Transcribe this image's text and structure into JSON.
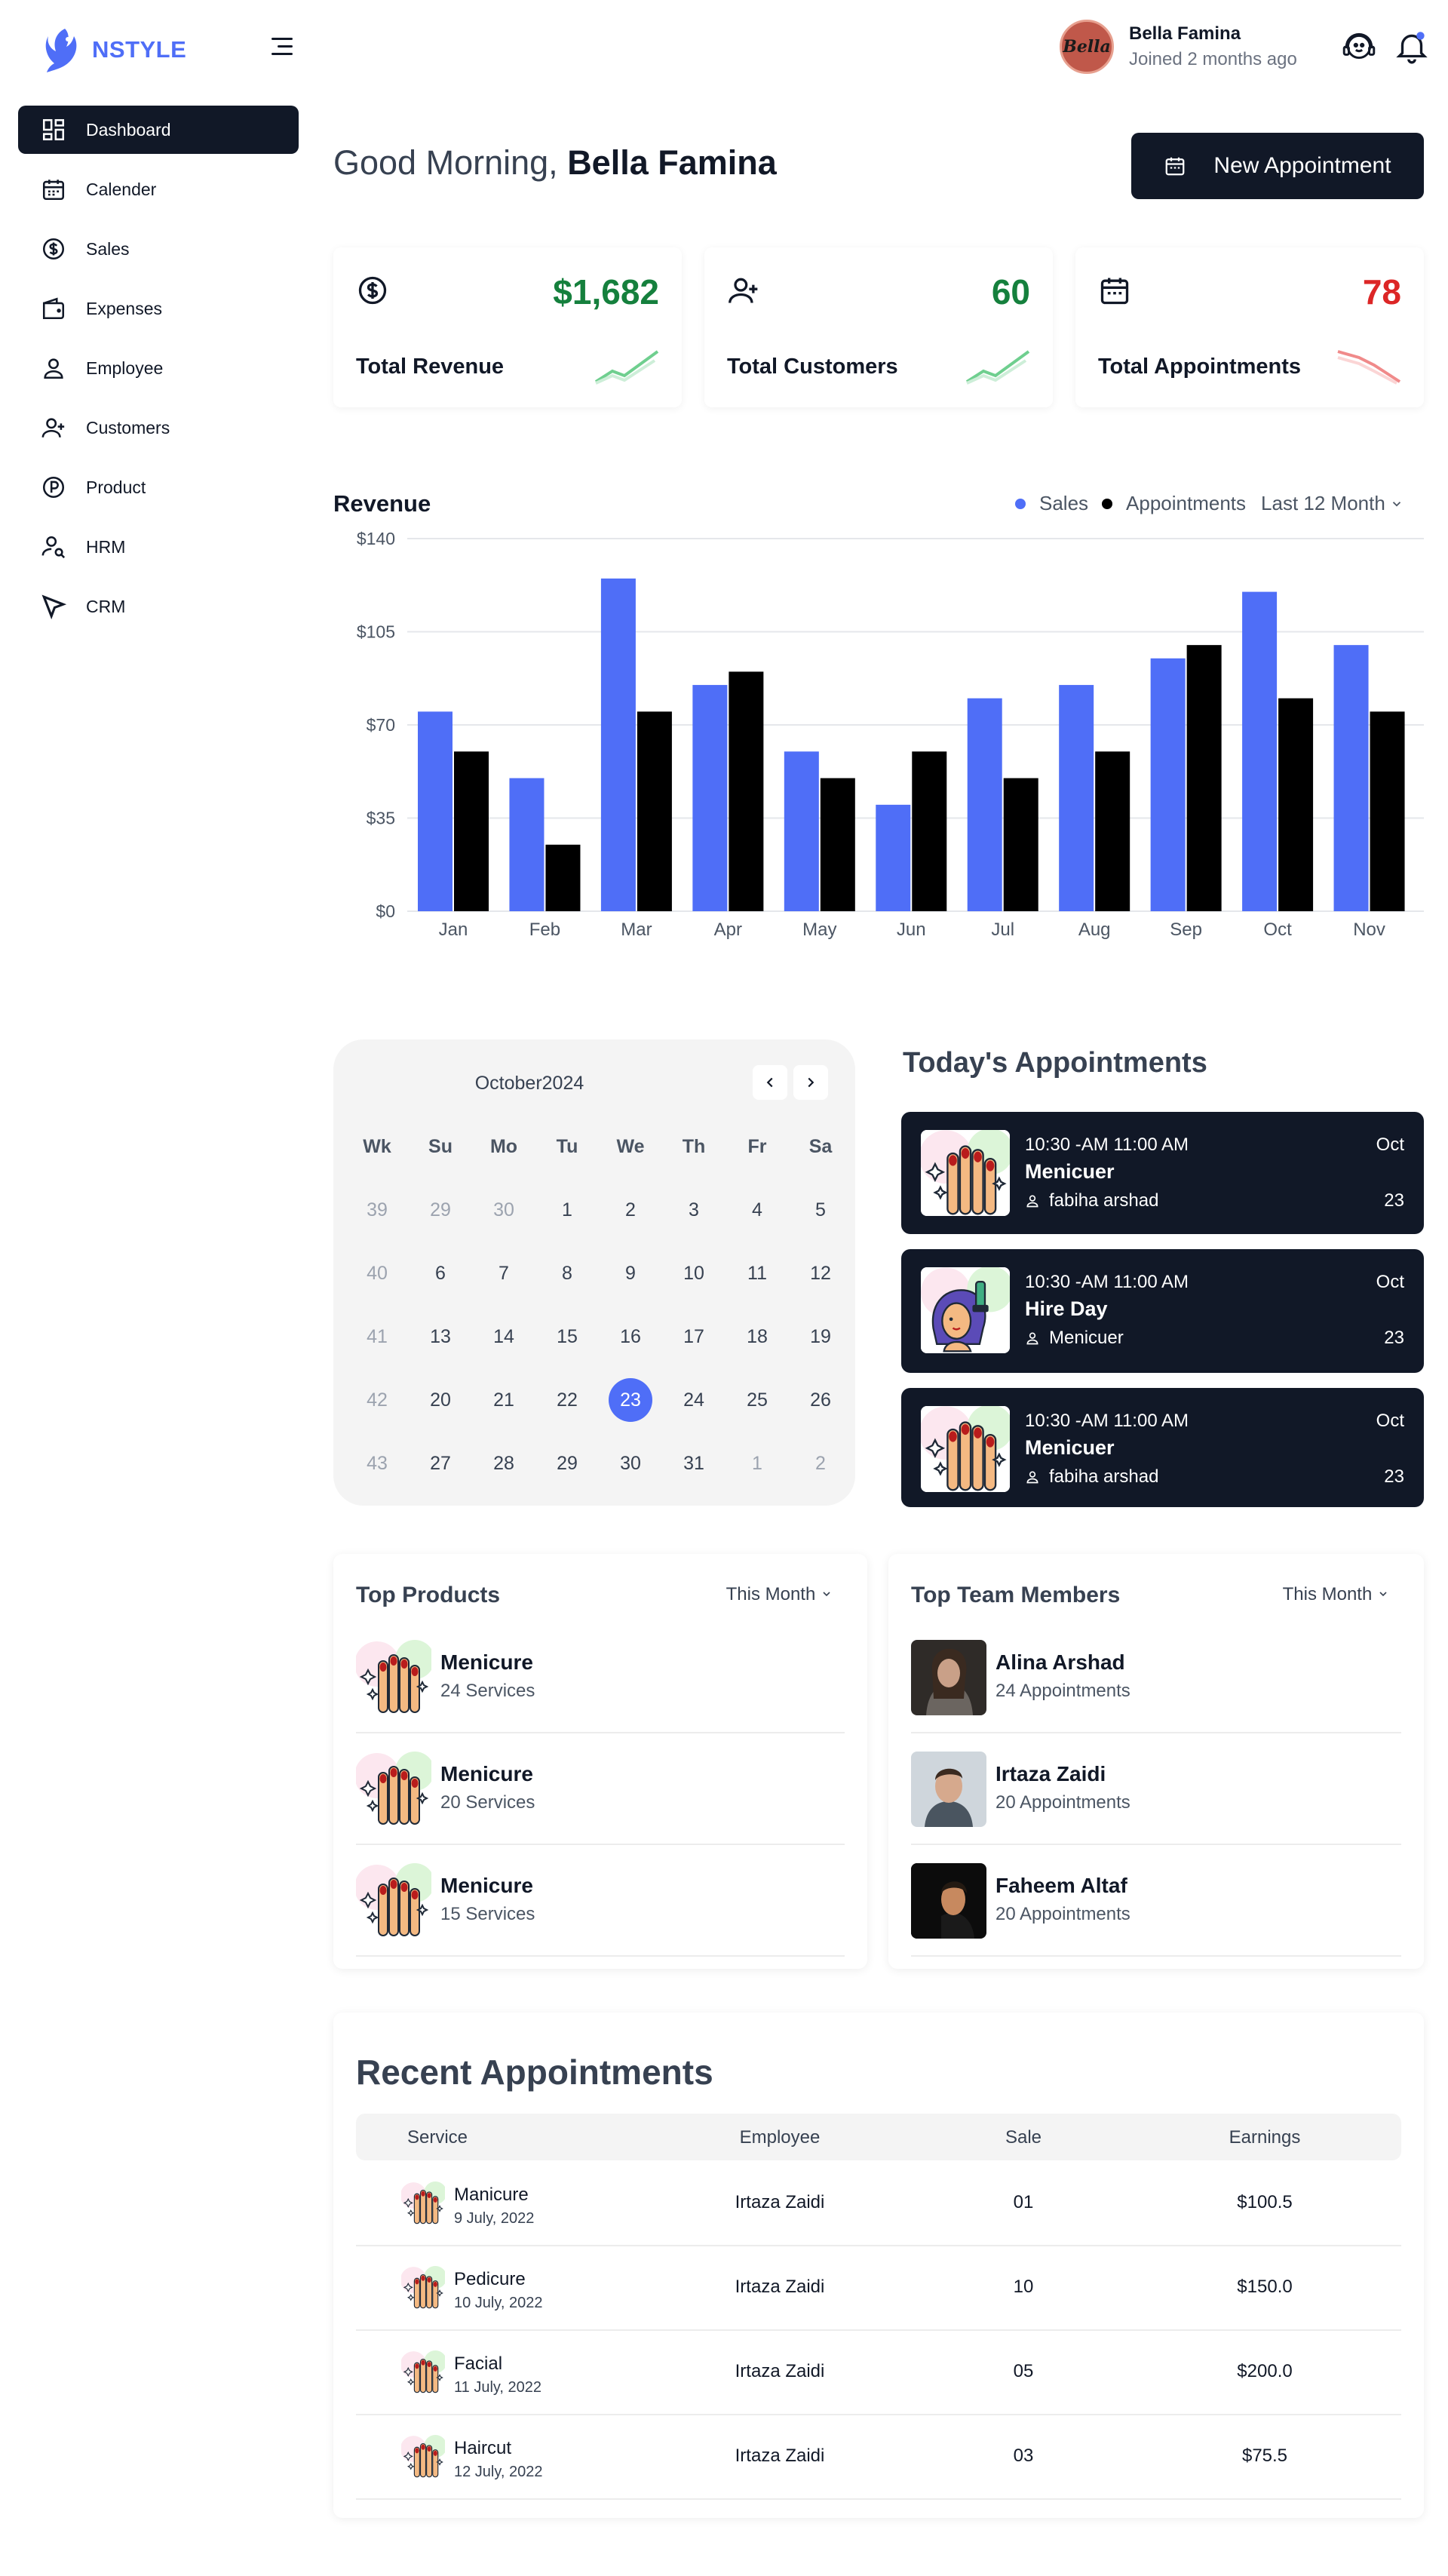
{
  "brand": {
    "name": "NSTYLE",
    "color": "#4f6ef7"
  },
  "sidebar": {
    "items": [
      {
        "label": "Dashboard",
        "icon": "dashboard-icon",
        "active": true
      },
      {
        "label": "Calender",
        "icon": "calendar-icon"
      },
      {
        "label": "Sales",
        "icon": "dollar-circle-icon"
      },
      {
        "label": "Expenses",
        "icon": "wallet-icon"
      },
      {
        "label": "Employee",
        "icon": "user-icon"
      },
      {
        "label": "Customers",
        "icon": "user-plus-icon"
      },
      {
        "label": "Product",
        "icon": "product-p-icon"
      },
      {
        "label": "HRM",
        "icon": "user-search-icon"
      },
      {
        "label": "CRM",
        "icon": "send-arrow-icon"
      }
    ]
  },
  "header": {
    "profile_name": "Bella Famina",
    "profile_joined": "Joined 2 months ago",
    "avatar_text": "Bella",
    "support_icon": "headset-icon",
    "notification_icon": "bell-icon"
  },
  "greeting": {
    "prefix": "Good Morning,",
    "name": "Bella Famina"
  },
  "new_appointment": {
    "label": "New Appointment"
  },
  "stats": [
    {
      "value": "$1,682",
      "label": "Total Revenue",
      "value_color": "#15803d",
      "trend": "up"
    },
    {
      "value": "60",
      "label": "Total Customers",
      "value_color": "#15803d",
      "trend": "up"
    },
    {
      "value": "78",
      "label": "Total Appointments",
      "value_color": "#dc2626",
      "trend": "down"
    }
  ],
  "revenue": {
    "title": "Revenue",
    "legend": [
      {
        "name": "Sales",
        "color": "#4f6ef7"
      },
      {
        "name": "Appointments",
        "color": "#000000"
      }
    ],
    "filter": "Last 12 Month"
  },
  "chart_data": {
    "type": "bar",
    "categories": [
      "Jan",
      "Feb",
      "Mar",
      "Apr",
      "May",
      "Jun",
      "Jul",
      "Aug",
      "Sep",
      "Oct",
      "Nov"
    ],
    "series": [
      {
        "name": "Sales",
        "values": [
          75,
          50,
          125,
          85,
          60,
          40,
          80,
          85,
          95,
          120,
          100
        ]
      },
      {
        "name": "Appointments",
        "values": [
          60,
          25,
          75,
          90,
          50,
          60,
          50,
          60,
          100,
          80,
          75
        ]
      }
    ],
    "ylim": [
      0,
      140
    ],
    "yticks": [
      "$0",
      "$35",
      "$70",
      "$105",
      "$140"
    ],
    "ytick_values": [
      0,
      35,
      70,
      105,
      140
    ],
    "grid": true,
    "legend_position": "top-right"
  },
  "calendar": {
    "title": "October2024",
    "headers": [
      "Wk",
      "Su",
      "Mo",
      "Tu",
      "We",
      "Th",
      "Fr",
      "Sa"
    ],
    "weeks": [
      [
        "39",
        "29",
        "30",
        "1",
        "2",
        "3",
        "4",
        "5"
      ],
      [
        "40",
        "6",
        "7",
        "8",
        "9",
        "10",
        "11",
        "12"
      ],
      [
        "41",
        "13",
        "14",
        "15",
        "16",
        "17",
        "18",
        "19"
      ],
      [
        "42",
        "20",
        "21",
        "22",
        "23",
        "24",
        "25",
        "26"
      ],
      [
        "43",
        "27",
        "28",
        "29",
        "30",
        "31",
        "1",
        "2"
      ]
    ],
    "selected": "23"
  },
  "today": {
    "title": "Today's Appointments",
    "items": [
      {
        "time": "10:30 -AM 11:00 AM",
        "service": "Menicuer",
        "person": "fabiha arshad",
        "month": "Oct",
        "day": "23",
        "image": "manicure-illustration"
      },
      {
        "time": "10:30 -AM 11:00 AM",
        "service": "Hire Day",
        "person": "Menicuer",
        "month": "Oct",
        "day": "23",
        "image": "hair-dye-illustration"
      },
      {
        "time": "10:30 -AM 11:00 AM",
        "service": "Menicuer",
        "person": "fabiha arshad",
        "month": "Oct",
        "day": "23",
        "image": "manicure-illustration"
      }
    ]
  },
  "top_products": {
    "title": "Top Products",
    "filter": "This Month",
    "items": [
      {
        "name": "Menicure",
        "sub": "24 Services"
      },
      {
        "name": "Menicure",
        "sub": "20 Services"
      },
      {
        "name": "Menicure",
        "sub": "15 Services"
      }
    ]
  },
  "top_team": {
    "title": "Top Team Members",
    "filter": "This Month",
    "items": [
      {
        "name": "Alina Arshad",
        "sub": "24 Appointments"
      },
      {
        "name": "Irtaza Zaidi",
        "sub": "20 Appointments"
      },
      {
        "name": "Faheem Altaf",
        "sub": "20 Appointments"
      }
    ]
  },
  "recent": {
    "title": "Recent Appointments",
    "columns": [
      "Service",
      "Employee",
      "Sale",
      "Earnings"
    ],
    "rows": [
      {
        "service": "Manicure",
        "date": "9 July, 2022",
        "employee": "Irtaza Zaidi",
        "sale": "01",
        "earnings": "$100.5"
      },
      {
        "service": "Pedicure",
        "date": "10 July, 2022",
        "employee": "Irtaza Zaidi",
        "sale": "10",
        "earnings": "$150.0"
      },
      {
        "service": "Facial",
        "date": "11 July, 2022",
        "employee": "Irtaza Zaidi",
        "sale": "05",
        "earnings": "$200.0"
      },
      {
        "service": "Haircut",
        "date": "12 July, 2022",
        "employee": "Irtaza Zaidi",
        "sale": "03",
        "earnings": "$75.5"
      }
    ]
  }
}
